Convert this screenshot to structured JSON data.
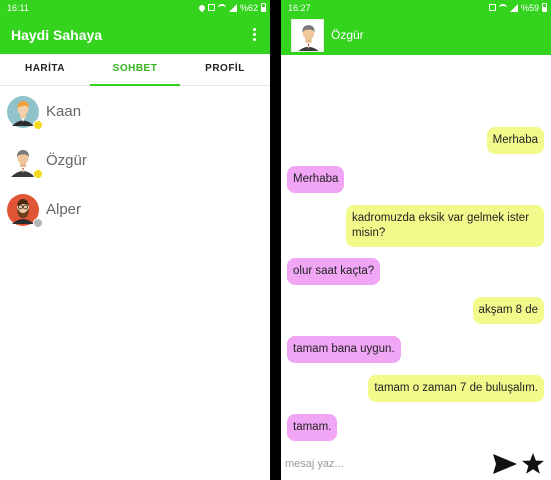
{
  "left": {
    "status": {
      "time": "16:11",
      "battery": "%62"
    },
    "app_title": "Haydi Sahaya",
    "tabs": [
      {
        "label": "HARİTA"
      },
      {
        "label": "SOHBET"
      },
      {
        "label": "PROFİL"
      }
    ],
    "contacts": [
      {
        "name": "Kaan"
      },
      {
        "name": "Özgür"
      },
      {
        "name": "Alper"
      }
    ]
  },
  "right": {
    "status": {
      "time": "16:27",
      "battery": "%59"
    },
    "chat_name": "Özgür",
    "messages": [
      {
        "text": "Merhaba"
      },
      {
        "text": "Merhaba"
      },
      {
        "text": "kadromuzda eksik var gelmek ister misin?"
      },
      {
        "text": "olur saat kaçta?"
      },
      {
        "text": "akşam 8 de"
      },
      {
        "text": "tamam bana uygun."
      },
      {
        "text": "tamam o zaman 7 de buluşalım."
      },
      {
        "text": "tamam."
      }
    ],
    "composer_placeholder": "mesaj yaz..."
  },
  "colors": {
    "accent": "#33d31e",
    "tab_active": "#33b51e",
    "bubble_me": "#f2fa8c",
    "bubble_other": "#f0a6f4",
    "presence_online": "#f5dc1a",
    "presence_offline": "#b5b5b5"
  },
  "icons": [
    "location-icon",
    "mute-icon",
    "wifi-icon",
    "signal-icon",
    "battery-icon",
    "more-vert-icon",
    "send-icon",
    "star-icon"
  ]
}
